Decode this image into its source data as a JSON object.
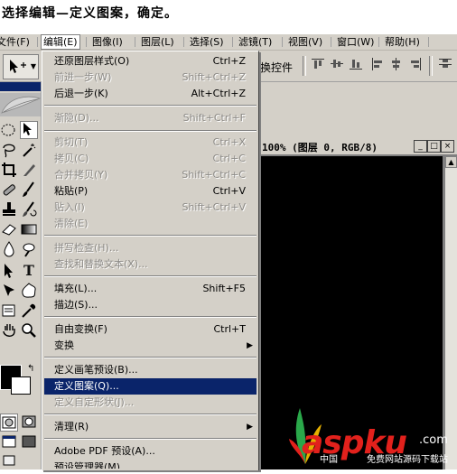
{
  "instruction": "选择编辑—定义图案，确定。",
  "menubar": [
    "文件(F)",
    "编辑(E)",
    "图像(I)",
    "图层(L)",
    "选择(S)",
    "滤镜(T)",
    "视图(V)",
    "窗口(W)",
    "帮助(H)"
  ],
  "options_bar": {
    "transform_label": "换控件"
  },
  "document": {
    "title": "100% (图层 0, RGB/8)"
  },
  "edit_menu": {
    "group1": [
      {
        "label": "还原图层样式(O)",
        "shortcut": "Ctrl+Z",
        "disabled": false
      },
      {
        "label": "前进一步(W)",
        "shortcut": "Shift+Ctrl+Z",
        "disabled": true
      },
      {
        "label": "后退一步(K)",
        "shortcut": "Alt+Ctrl+Z",
        "disabled": false
      }
    ],
    "group2": [
      {
        "label": "渐隐(D)...",
        "shortcut": "Shift+Ctrl+F",
        "disabled": true
      }
    ],
    "group3": [
      {
        "label": "剪切(T)",
        "shortcut": "Ctrl+X",
        "disabled": true
      },
      {
        "label": "拷贝(C)",
        "shortcut": "Ctrl+C",
        "disabled": true
      },
      {
        "label": "合并拷贝(Y)",
        "shortcut": "Shift+Ctrl+C",
        "disabled": true
      },
      {
        "label": "粘贴(P)",
        "shortcut": "Ctrl+V",
        "disabled": false
      },
      {
        "label": "贴入(I)",
        "shortcut": "Shift+Ctrl+V",
        "disabled": true
      },
      {
        "label": "清除(E)",
        "shortcut": "",
        "disabled": true
      }
    ],
    "group4": [
      {
        "label": "拼写检查(H)...",
        "shortcut": "",
        "disabled": true
      },
      {
        "label": "查找和替换文本(X)...",
        "shortcut": "",
        "disabled": true
      }
    ],
    "group5": [
      {
        "label": "填充(L)...",
        "shortcut": "Shift+F5",
        "disabled": false
      },
      {
        "label": "描边(S)...",
        "shortcut": "",
        "disabled": false
      }
    ],
    "group6": [
      {
        "label": "自由变换(F)",
        "shortcut": "Ctrl+T",
        "disabled": false
      },
      {
        "label": "变换",
        "shortcut": "",
        "disabled": false,
        "submenu": true
      }
    ],
    "group7": [
      {
        "label": "定义画笔预设(B)...",
        "shortcut": "",
        "disabled": false
      },
      {
        "label": "定义图案(Q)...",
        "shortcut": "",
        "disabled": false,
        "highlighted": true
      },
      {
        "label": "定义自定形状(J)...",
        "shortcut": "",
        "disabled": true
      }
    ],
    "group8": [
      {
        "label": "清理(R)",
        "shortcut": "",
        "disabled": false,
        "submenu": true
      }
    ],
    "group9": [
      {
        "label": "Adobe PDF 预设(A)...",
        "shortcut": "",
        "disabled": false
      },
      {
        "label": "预设管理器(M)...",
        "shortcut": "",
        "disabled": false
      }
    ]
  },
  "watermark": {
    "brand": "aspku",
    "suffix": ".com",
    "subtitle": "免费网站源码下载站",
    "cn": "中国"
  },
  "colors": {
    "highlight": "#0a246a",
    "menu_bg": "#d4d0c8",
    "watermark_red": "#e2211c"
  },
  "icons": [
    "move-icon",
    "marquee-icon",
    "lasso-icon",
    "crop-icon",
    "brush-icon",
    "stamp-icon",
    "eraser-icon",
    "gradient-icon",
    "blur-icon",
    "dodge-icon",
    "path-select-icon",
    "type-icon",
    "pen-icon",
    "shape-icon",
    "notes-icon",
    "eyedropper-icon",
    "hand-icon",
    "zoom-icon"
  ]
}
